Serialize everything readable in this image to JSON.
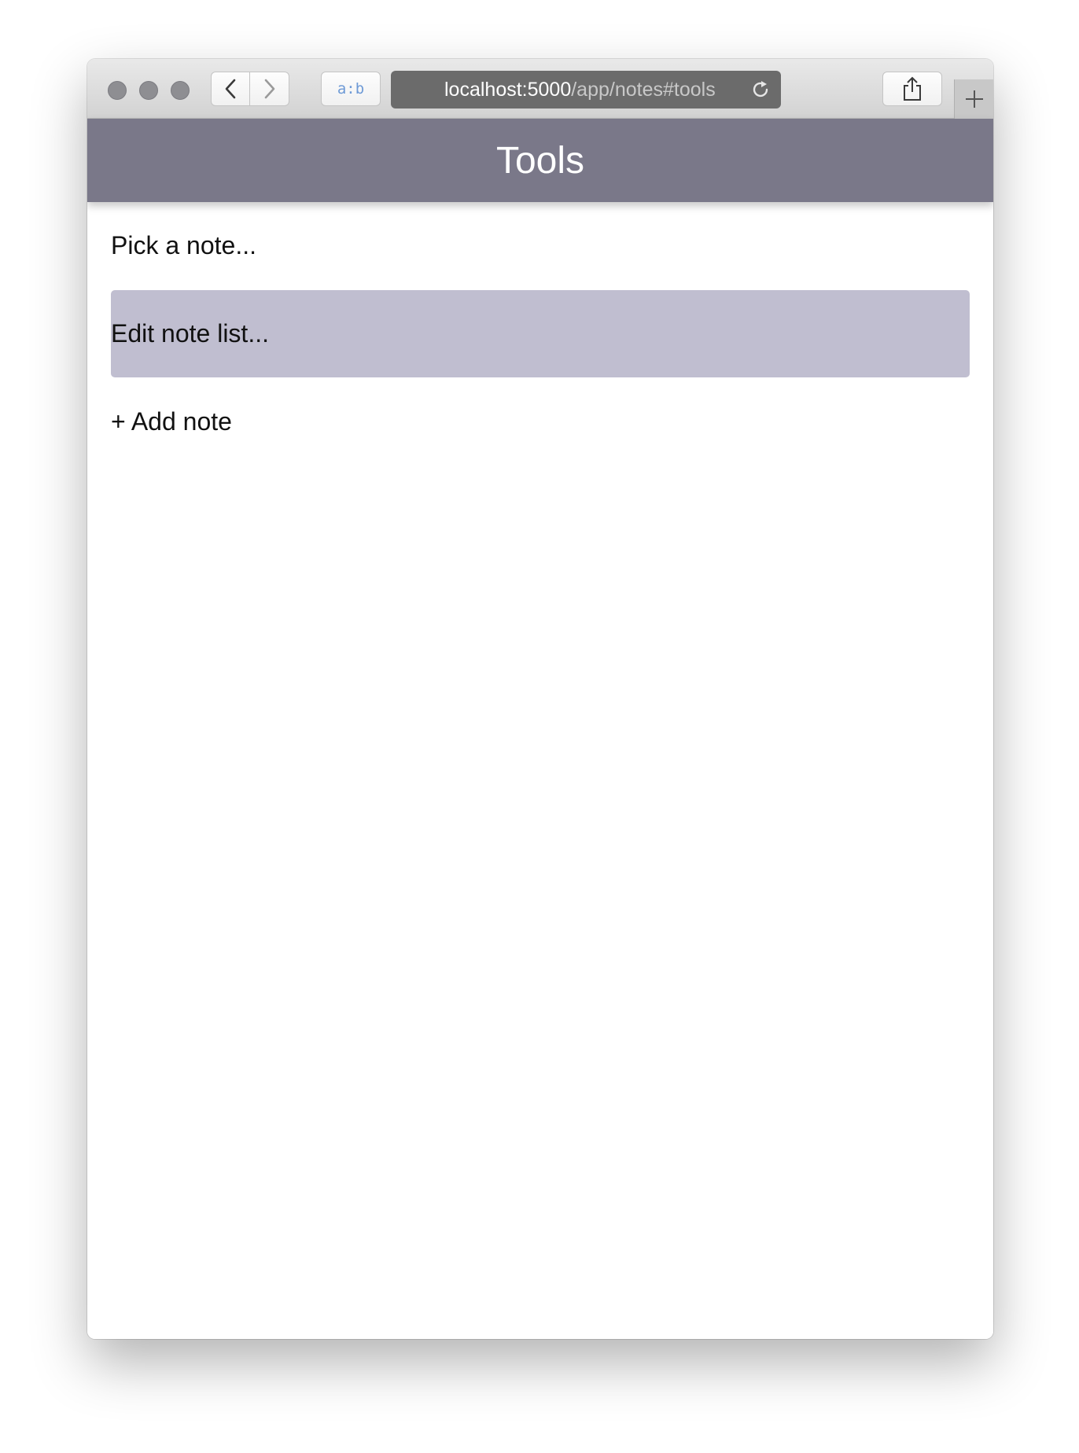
{
  "browser": {
    "reader_label": "a:b",
    "url_host": "localhost:5000",
    "url_path": "/app/notes#tools",
    "icons": {
      "back": "chevron-left-icon",
      "forward": "chevron-right-icon",
      "reload": "reload-icon",
      "share": "share-icon",
      "new_tab": "plus-icon"
    }
  },
  "header": {
    "title": "Tools",
    "color": "#7a7889"
  },
  "menu": {
    "items": [
      {
        "label": "Pick a note..."
      },
      {
        "label": "Edit note list..."
      },
      {
        "label": "+ Add note"
      }
    ],
    "highlight_color": "#c0bed0"
  }
}
